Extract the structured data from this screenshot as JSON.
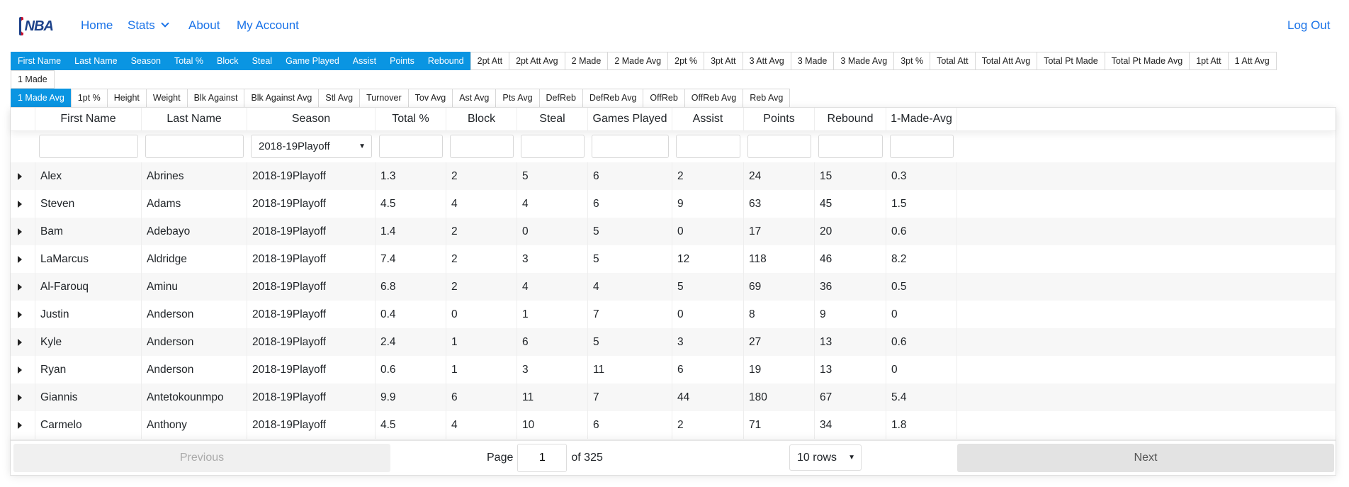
{
  "nav": {
    "logo": "NBA",
    "links": [
      "Home",
      "Stats",
      "About",
      "My Account"
    ],
    "logout": "Log Out"
  },
  "toolbar": {
    "row1": [
      {
        "label": "First Name",
        "active": true
      },
      {
        "label": "Last Name",
        "active": true
      },
      {
        "label": "Season",
        "active": true
      },
      {
        "label": "Total %",
        "active": true
      },
      {
        "label": "Block",
        "active": true
      },
      {
        "label": "Steal",
        "active": true
      },
      {
        "label": "Game Played",
        "active": true
      },
      {
        "label": "Assist",
        "active": true
      },
      {
        "label": "Points",
        "active": true
      },
      {
        "label": "Rebound",
        "active": true
      },
      {
        "label": "2pt Att",
        "active": false
      },
      {
        "label": "2pt Att Avg",
        "active": false
      },
      {
        "label": "2 Made",
        "active": false
      },
      {
        "label": "2 Made Avg",
        "active": false
      },
      {
        "label": "2pt %",
        "active": false
      },
      {
        "label": "3pt Att",
        "active": false
      },
      {
        "label": "3 Att Avg",
        "active": false
      },
      {
        "label": "3 Made",
        "active": false
      },
      {
        "label": "3 Made Avg",
        "active": false
      },
      {
        "label": "3pt %",
        "active": false
      },
      {
        "label": "Total Att",
        "active": false
      },
      {
        "label": "Total Att Avg",
        "active": false
      },
      {
        "label": "Total Pt Made",
        "active": false
      },
      {
        "label": "Total Pt Made Avg",
        "active": false
      },
      {
        "label": "1pt Att",
        "active": false
      },
      {
        "label": "1 Att Avg",
        "active": false
      },
      {
        "label": "1 Made",
        "active": false
      }
    ],
    "row2": [
      {
        "label": "1 Made Avg",
        "active": true
      },
      {
        "label": "1pt %",
        "active": false
      },
      {
        "label": "Height",
        "active": false
      },
      {
        "label": "Weight",
        "active": false
      },
      {
        "label": "Blk Against",
        "active": false
      },
      {
        "label": "Blk Against Avg",
        "active": false
      },
      {
        "label": "Stl Avg",
        "active": false
      },
      {
        "label": "Turnover",
        "active": false
      },
      {
        "label": "Tov Avg",
        "active": false
      },
      {
        "label": "Ast Avg",
        "active": false
      },
      {
        "label": "Pts Avg",
        "active": false
      },
      {
        "label": "DefReb",
        "active": false
      },
      {
        "label": "DefReb Avg",
        "active": false
      },
      {
        "label": "OffReb",
        "active": false
      },
      {
        "label": "OffReb Avg",
        "active": false
      },
      {
        "label": "Reb Avg",
        "active": false
      }
    ]
  },
  "accent": "#0a95e2",
  "table": {
    "columns": [
      "First Name",
      "Last Name",
      "Season",
      "Total %",
      "Block",
      "Steal",
      "Games Played",
      "Assist",
      "Points",
      "Rebound",
      "1-Made-Avg"
    ],
    "season_filter": "2018-19Playoff",
    "rows": [
      [
        "Alex",
        "Abrines",
        "2018-19Playoff",
        "1.3",
        "2",
        "5",
        "6",
        "2",
        "24",
        "15",
        "0.3"
      ],
      [
        "Steven",
        "Adams",
        "2018-19Playoff",
        "4.5",
        "4",
        "4",
        "6",
        "9",
        "63",
        "45",
        "1.5"
      ],
      [
        "Bam",
        "Adebayo",
        "2018-19Playoff",
        "1.4",
        "2",
        "0",
        "5",
        "0",
        "17",
        "20",
        "0.6"
      ],
      [
        "LaMarcus",
        "Aldridge",
        "2018-19Playoff",
        "7.4",
        "2",
        "3",
        "5",
        "12",
        "118",
        "46",
        "8.2"
      ],
      [
        "Al-Farouq",
        "Aminu",
        "2018-19Playoff",
        "6.8",
        "2",
        "4",
        "4",
        "5",
        "69",
        "36",
        "0.5"
      ],
      [
        "Justin",
        "Anderson",
        "2018-19Playoff",
        "0.4",
        "0",
        "1",
        "7",
        "0",
        "8",
        "9",
        "0"
      ],
      [
        "Kyle",
        "Anderson",
        "2018-19Playoff",
        "2.4",
        "1",
        "6",
        "5",
        "3",
        "27",
        "13",
        "0.6"
      ],
      [
        "Ryan",
        "Anderson",
        "2018-19Playoff",
        "0.6",
        "1",
        "3",
        "11",
        "6",
        "19",
        "13",
        "0"
      ],
      [
        "Giannis",
        "Antetokounmpo",
        "2018-19Playoff",
        "9.9",
        "6",
        "11",
        "7",
        "44",
        "180",
        "67",
        "5.4"
      ],
      [
        "Carmelo",
        "Anthony",
        "2018-19Playoff",
        "4.5",
        "4",
        "10",
        "6",
        "2",
        "71",
        "34",
        "1.8"
      ]
    ]
  },
  "pagination": {
    "previous": "Previous",
    "next": "Next",
    "page_label": "Page",
    "page": "1",
    "of_label": "of 325",
    "rows": "10 rows"
  }
}
